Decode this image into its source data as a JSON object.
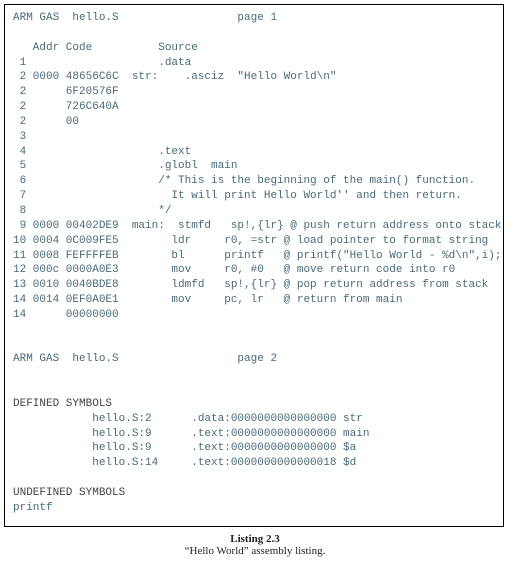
{
  "header1": "ARM GAS  hello.S                  page 1",
  "cols": "   Addr Code          Source",
  "l1": " 1                    .data",
  "l2": " 2 0000 48656C6C  str:    .asciz  \"Hello World\\n\"",
  "l2b": " 2      6F20576F",
  "l2c": " 2      726C640A",
  "l2d": " 2      00",
  "l3": " 3",
  "l4": " 4                    .text",
  "l5": " 5                    .globl  main",
  "l6": " 6                    /* This is the beginning of the main() function.",
  "l7": " 7                      It will print Hello World'' and then return.",
  "l8": " 8                    */",
  "l9": " 9 0000 00402DE9  main:  stmfd   sp!,{lr} @ push return address onto stack",
  "l10": "10 0004 0C009FE5        ldr     r0, =str @ load pointer to format string",
  "l11": "11 0008 FEFFFFEB        bl      printf   @ printf(\"Hello World - %d\\n\",i);",
  "l12": "12 000c 0000A0E3        mov     r0, #0   @ move return code into r0",
  "l13": "13 0010 0040BDE8        ldmfd   sp!,{lr} @ pop return address from stack",
  "l14": "14 0014 0EF0A0E1        mov     pc, lr   @ return from main",
  "l14b": "14      00000000",
  "header2": "ARM GAS  hello.S                  page 2",
  "defsym": "DEFINED SYMBOLS",
  "ds1": "            hello.S:2      .data:0000000000000000 str",
  "ds2": "            hello.S:9      .text:0000000000000000 main",
  "ds3": "            hello.S:9      .text:0000000000000000 $a",
  "ds4": "            hello.S:14     .text:0000000000000018 $d",
  "undefsym": "UNDEFINED SYMBOLS",
  "us1": "printf",
  "caption_title": "Listing 2.3",
  "caption_sub": "“Hello World” assembly listing."
}
